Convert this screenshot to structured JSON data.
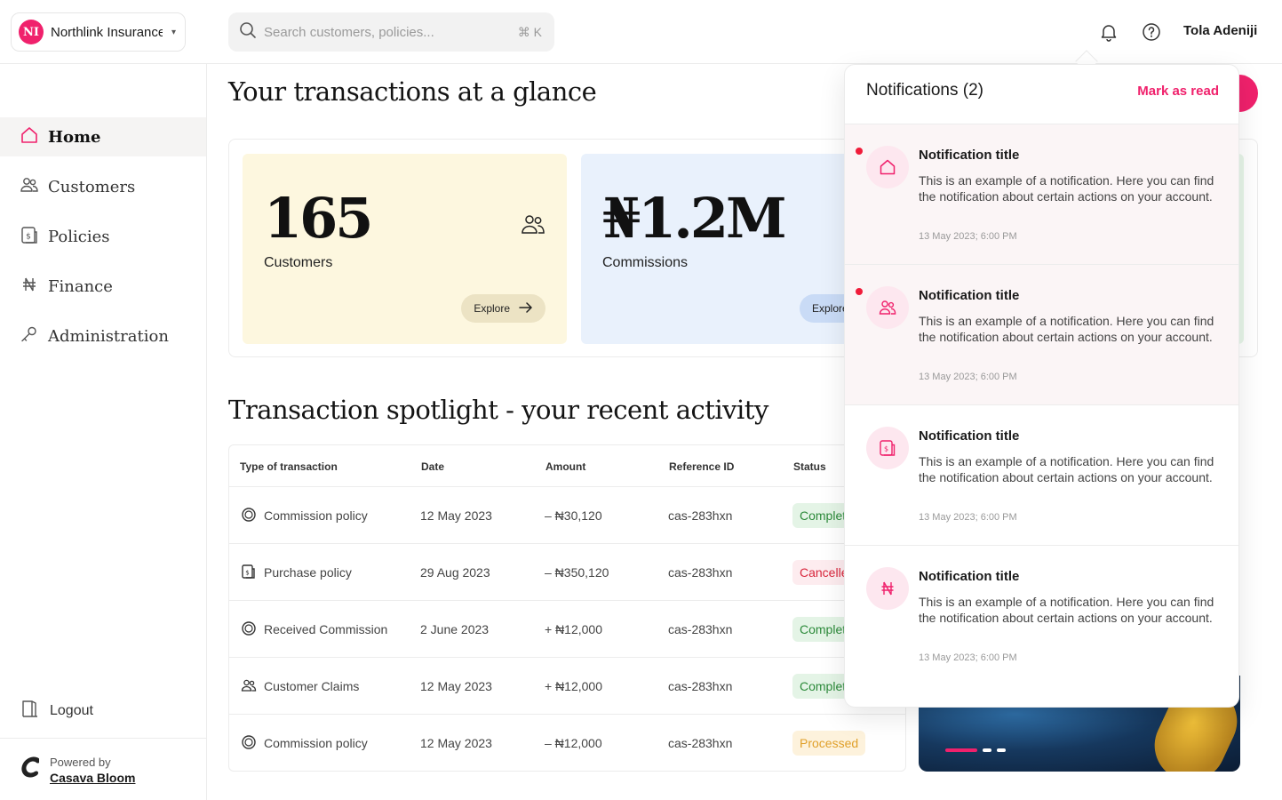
{
  "topbar": {
    "org_initials": "NI",
    "org_name": "Northlink Insurance",
    "search_placeholder": "Search customers, policies...",
    "search_shortcut": "⌘ K",
    "user_name": "Tola Adeniji"
  },
  "sidebar": {
    "items": [
      {
        "label": "Home",
        "icon": "home-icon"
      },
      {
        "label": "Customers",
        "icon": "users-icon"
      },
      {
        "label": "Policies",
        "icon": "policy-icon"
      },
      {
        "label": "Finance",
        "icon": "naira-icon"
      },
      {
        "label": "Administration",
        "icon": "key-icon"
      }
    ],
    "logout_label": "Logout",
    "powered_by": "Powered by",
    "brand": "Casava Bloom"
  },
  "main": {
    "overview_title": "Your transactions at a glance",
    "stats": [
      {
        "value": "165",
        "label": "Customers",
        "explore": "Explore",
        "color": "#fdf7df"
      },
      {
        "value": "₦1.2M",
        "label": "Commissions",
        "explore": "Explore",
        "color": "#e9f1fc"
      }
    ],
    "spotlight_title": "Transaction spotlight - your recent activity",
    "table": {
      "columns": [
        "Type of transaction",
        "Date",
        "Amount",
        "Reference ID",
        "Status"
      ],
      "rows": [
        {
          "type": "Commission policy",
          "icon": "coin-icon",
          "date": "12 May 2023",
          "amount": "– ₦30,120",
          "ref": "cas-283hxn",
          "status": "Completed",
          "status_kind": "completed"
        },
        {
          "type": "Purchase policy",
          "icon": "policy-icon",
          "date": "29 Aug 2023",
          "amount": "– ₦350,120",
          "ref": "cas-283hxn",
          "status": "Cancelled",
          "status_kind": "cancelled"
        },
        {
          "type": "Received Commission",
          "icon": "coin-icon",
          "date": "2 June 2023",
          "amount": "+ ₦12,000",
          "ref": "cas-283hxn",
          "status": "Completed",
          "status_kind": "completed"
        },
        {
          "type": "Customer Claims",
          "icon": "users-icon",
          "date": "12 May 2023",
          "amount": "+ ₦12,000",
          "ref": "cas-283hxn",
          "status": "Completed",
          "status_kind": "completed"
        },
        {
          "type": "Commission policy",
          "icon": "coin-icon",
          "date": "12 May 2023",
          "amount": "– ₦12,000",
          "ref": "cas-283hxn",
          "status": "Processed",
          "status_kind": "processed"
        }
      ]
    }
  },
  "notifications": {
    "title": "Notifications (2)",
    "mark_as_read": "Mark as read",
    "items": [
      {
        "title": "Notification title",
        "body": "This is an example of a notification. Here you can find the notification about certain actions on your account.",
        "time": "13 May 2023; 6:00 PM",
        "unread": true,
        "icon": "home-icon"
      },
      {
        "title": "Notification title",
        "body": "This is an example of a notification. Here you can find the notification about certain actions on your account.",
        "time": "13 May 2023; 6:00 PM",
        "unread": true,
        "icon": "users-icon"
      },
      {
        "title": "Notification title",
        "body": "This is an example of a notification. Here you can find the notification about certain actions on your account.",
        "time": "13 May 2023; 6:00 PM",
        "unread": false,
        "icon": "policy-icon"
      },
      {
        "title": "Notification title",
        "body": "This is an example of a notification. Here you can find the notification about certain actions on your account.",
        "time": "13 May 2023; 6:00 PM",
        "unread": false,
        "icon": "naira-icon"
      }
    ]
  },
  "colors": {
    "accent": "#f0216c",
    "completed": "#2c8a3a",
    "cancelled": "#d8263c",
    "processed": "#e0a02a"
  }
}
